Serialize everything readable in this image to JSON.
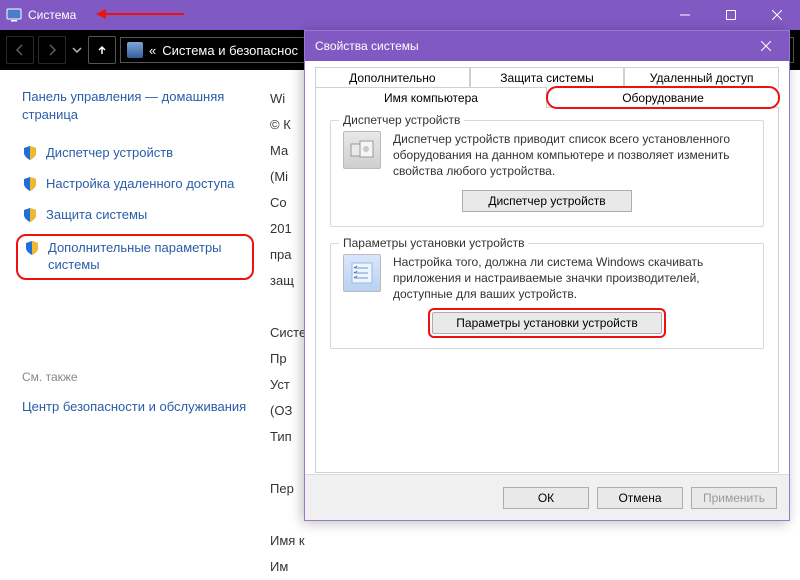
{
  "main": {
    "title": "Система",
    "breadcrumb_prefix": "«",
    "breadcrumb": "Система и безопаснос"
  },
  "left": {
    "home": "Панель управления — домашняя страница",
    "links": [
      "Диспетчер устройств",
      "Настройка удаленного доступа",
      "Защита системы",
      "Дополнительные параметры системы"
    ],
    "also_label": "См. также",
    "also_link": "Центр безопасности и обслуживания"
  },
  "mid": {
    "lines": [
      "Wi",
      "© К",
      "Ма",
      "(Mi",
      "Co",
      "201",
      "пра",
      "защ",
      "",
      "Систем",
      "Пр",
      "Уст",
      "(ОЗ",
      "Тип",
      "",
      "Пер",
      "",
      "Имя к",
      "Им"
    ]
  },
  "dialog": {
    "title": "Свойства системы",
    "tabs_top": [
      "Дополнительно",
      "Защита системы",
      "Удаленный доступ"
    ],
    "tabs_bottom": [
      "Имя компьютера",
      "Оборудование"
    ],
    "group1": {
      "legend": "Диспетчер устройств",
      "text": "Диспетчер устройств приводит список всего установленного оборудования на данном компьютере и позволяет изменить свойства любого устройства.",
      "button": "Диспетчер устройств"
    },
    "group2": {
      "legend": "Параметры установки устройств",
      "text": "Настройка того, должна ли система Windows скачивать приложения и настраиваемые значки производителей, доступные для ваших устройств.",
      "button": "Параметры установки устройств"
    },
    "buttons": {
      "ok": "ОК",
      "cancel": "Отмена",
      "apply": "Применить"
    }
  }
}
